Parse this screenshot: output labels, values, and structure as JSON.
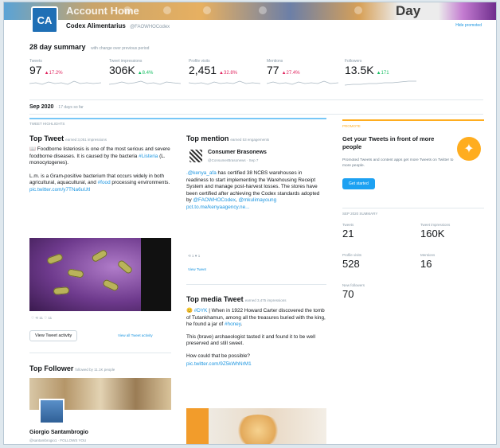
{
  "header": {
    "banner_title": "Account Home",
    "banner_day": "Day",
    "avatar_initials": "CA",
    "account_name": "Codex Alimentarius",
    "account_handle": "@FAOWHOCodex",
    "top_right_link": "Hide promoted"
  },
  "summary": {
    "title": "28 day summary",
    "subtitle": "with change over previous period",
    "stats": [
      {
        "label": "Tweets",
        "value": "97",
        "change": "▲17.2%",
        "direction": "down"
      },
      {
        "label": "Tweet impressions",
        "value": "306K",
        "change": "▲8.4%",
        "direction": "up"
      },
      {
        "label": "Profile visits",
        "value": "2,451",
        "change": "▲32.8%",
        "direction": "down"
      },
      {
        "label": "Mentions",
        "value": "77",
        "change": "▲27.4%",
        "direction": "down"
      },
      {
        "label": "Followers",
        "value": "13.5K",
        "change": "▲171",
        "direction": "up"
      }
    ]
  },
  "month": {
    "label": "Sep 2020",
    "sub": "· 17 days so far",
    "highlights": "TWEET HIGHLIGHTS"
  },
  "top_tweet": {
    "title": "Top Tweet",
    "sub": "earned 3,051 impressions",
    "para1_a": "📖 Foodborne listeriosis is one of the most serious and severe foodborne diseases. It is caused by the bacteria ",
    "para1_link": "#Listeria",
    "para1_b": " (L. monocytogenes).",
    "para2_a": "L.m. is a Gram-positive bacterium that occurs widely in both agricultural, aquacultural, and ",
    "para2_link": "#food",
    "para2_b": " processing environments. ",
    "para2_url": "pic.twitter.com/y7TNa6uUtI",
    "actions": "♡  ⟲ 11  ♡ 11",
    "view_activity": "View Tweet activity",
    "view_all": "View all Tweet activity"
  },
  "top_mention": {
    "title": "Top mention",
    "sub": "earned 53 engagements",
    "author": "Consumer Brasonews",
    "author_handle": "@ConsumerBrasonews · Sep 7",
    "text_link1": ".@kenya_afa",
    "text_a": " has certified 38 NCBS warehouses in readiness to start implementing the Warehousing Receipt System and manage post-harvest losses. The stores have been certified after achieving the Codex standards adopted by ",
    "text_link2": "@FAOWHOCodex",
    "text_sep": ", ",
    "text_link3": "@mkulimayoung",
    "text_url": "pct.to.me/kenyaagency.ne...",
    "actions": "⟲ 1    ♥ 1",
    "view_tweet": "View Tweet"
  },
  "top_media": {
    "title": "Top media Tweet",
    "sub": "earned 3,475 impressions",
    "p1_a": "😊 ",
    "p1_link": "#DYK",
    "p1_b": " | When in 1922 Howard Carter discovered the tomb of Tutankhamun, among all the treasures buried with the king, he found a jar of ",
    "p1_link2": "#honey",
    "p1_c": ".",
    "p2": "This (brave) archaeologist tasted it and found it to be well preserved and still sweet.",
    "p3": "How could that be possible?",
    "url": "pic.twitter.com/9Z5kWhNrM1"
  },
  "top_follower": {
    "title": "Top Follower",
    "sub": "followed by 11.1K people",
    "name": "Giorgio Santambrogio",
    "handle": "@santambrogio1 · FOLLOWS YOU"
  },
  "promo": {
    "title": "Get your Tweets in front of more people",
    "text": "Promoted Tweets and content apps get more Tweets on Twitter to more people.",
    "button": "Get started",
    "icon": "megaphone-icon"
  },
  "sidebar_summary": {
    "title": "SEP 2020 SUMMARY",
    "stats": [
      {
        "label": "Tweets",
        "value": "21"
      },
      {
        "label": "Tweet impressions",
        "value": "160K"
      },
      {
        "label": "Profile visits",
        "value": "528"
      },
      {
        "label": "Mentions",
        "value": "16"
      },
      {
        "label": "New followers",
        "value": "70"
      }
    ]
  },
  "colors": {
    "accent": "#1da1f2",
    "down": "#e0245e",
    "up": "#17bf63",
    "promo": "#ffad1f"
  }
}
